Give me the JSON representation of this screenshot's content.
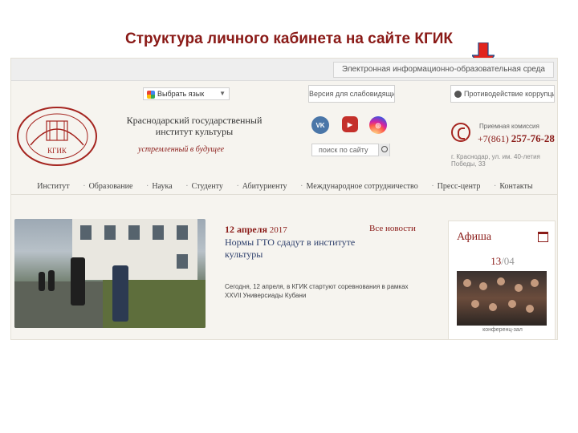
{
  "slide": {
    "title": "Структура личного кабинета на сайте КГИК"
  },
  "topbar": {
    "eservice": "Электронная информационно-образовательная среда"
  },
  "toolbar": {
    "language_button": "Выбрать язык",
    "visually_impaired": "Версия для слабовидящих",
    "anticorruption": "Противодействие коррупции"
  },
  "header": {
    "institution_name": "Краснодарский государственный институт культуры",
    "logo_text": "КГИК",
    "motto": "устремленный в будущее",
    "search_placeholder": "поиск по сайту",
    "phone_label": "Приемная комиссия",
    "phone_prefix": "+7(861)",
    "phone_number": "257-76-28",
    "address": "г. Краснодар, ул. им. 40-летия Победы, 33"
  },
  "nav": {
    "items": [
      "Институт",
      "Образование",
      "Наука",
      "Студенту",
      "Абитуриенту",
      "Международное сотрудничество",
      "Пресс-центр",
      "Контакты"
    ]
  },
  "news": {
    "day_month": "12 апреля",
    "year": "2017",
    "all_news": "Все новости",
    "title": "Нормы ГТО сдадут в институте культуры",
    "text": "Сегодня, 12 апреля, в КГИК стартуют соревнования в рамках XXVII Универсиады Кубани"
  },
  "afisha": {
    "title": "Афиша",
    "day": "13",
    "month": "/04",
    "caption": "конференц-зал"
  }
}
